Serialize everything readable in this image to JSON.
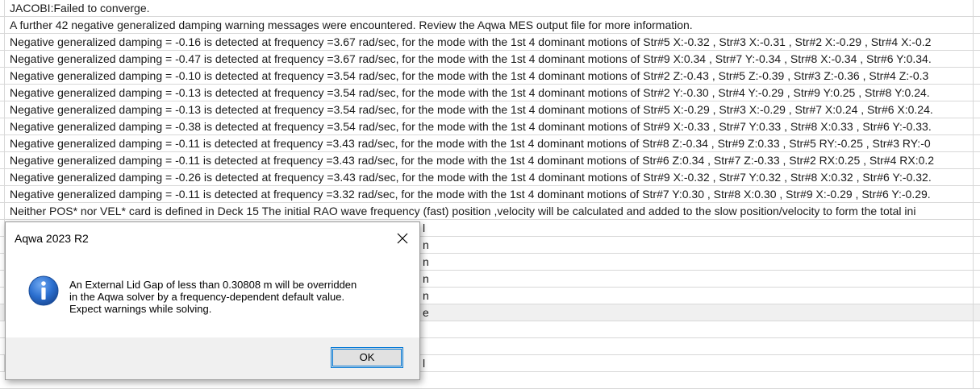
{
  "messages": [
    "JACOBI:Failed to converge.",
    "A further 42 negative generalized damping warning messages were encountered. Review the Aqwa MES output file for more information.",
    "Negative generalized damping = -0.16 is detected at frequency =3.67 rad/sec, for the mode with the 1st 4 dominant motions of Str#5 X:-0.32 , Str#3 X:-0.31 , Str#2 X:-0.29 , Str#4 X:-0.2",
    "Negative generalized damping = -0.47 is detected at frequency =3.67 rad/sec, for the mode with the 1st 4 dominant motions of Str#9 X:0.34 , Str#7 Y:-0.34 , Str#8 X:-0.34 , Str#6 Y:0.34.",
    "Negative generalized damping = -0.10 is detected at frequency =3.54 rad/sec, for the mode with the 1st 4 dominant motions of Str#2 Z:-0.43 , Str#5 Z:-0.39 , Str#3 Z:-0.36 , Str#4 Z:-0.3",
    "Negative generalized damping = -0.13 is detected at frequency =3.54 rad/sec, for the mode with the 1st 4 dominant motions of Str#2 Y:-0.30 , Str#4 Y:-0.29 , Str#9 Y:0.25 , Str#8 Y:0.24.",
    "Negative generalized damping = -0.13 is detected at frequency =3.54 rad/sec, for the mode with the 1st 4 dominant motions of Str#5 X:-0.29 , Str#3 X:-0.29 , Str#7 X:0.24 , Str#6 X:0.24.",
    "Negative generalized damping = -0.38 is detected at frequency =3.54 rad/sec, for the mode with the 1st 4 dominant motions of Str#9 X:-0.33 , Str#7 Y:0.33 , Str#8 X:0.33 , Str#6 Y:-0.33.",
    "Negative generalized damping = -0.11 is detected at frequency =3.43 rad/sec, for the mode with the 1st 4 dominant motions of Str#8 Z:-0.34 , Str#9 Z:0.33 , Str#5 RY:-0.25 , Str#3 RY:-0",
    "Negative generalized damping = -0.11 is detected at frequency =3.43 rad/sec, for the mode with the 1st 4 dominant motions of Str#6 Z:0.34 , Str#7 Z:-0.33 , Str#2 RX:0.25 , Str#4 RX:0.2",
    "Negative generalized damping = -0.26 is detected at frequency =3.43 rad/sec, for the mode with the 1st 4 dominant motions of Str#9 X:-0.32 , Str#7 Y:0.32 , Str#8 X:0.32 , Str#6 Y:-0.32.",
    "Negative generalized damping = -0.11 is detected at frequency =3.32 rad/sec, for the mode with the 1st 4 dominant motions of Str#7 Y:0.30 , Str#8 X:0.30 , Str#9 X:-0.29 , Str#6 Y:-0.29.",
    "Neither POS* nor VEL* card is defined in Deck 15 The initial RAO wave frequency (fast) position ,velocity will be calculated and added to the slow position/velocity to form the total ini"
  ],
  "hidden_rows": [
    "l",
    "n",
    "n",
    "n",
    "n",
    "e",
    "",
    "",
    "",
    "l"
  ],
  "dialog": {
    "title": "Aqwa 2023 R2",
    "message_lines": [
      " An External Lid Gap of less than 0.30808 m will be overridden",
      "in the Aqwa solver by a frequency-dependent default value.",
      "Expect warnings while solving."
    ],
    "ok_label": "OK"
  },
  "colors": {
    "grid_line": "#d8d8d8",
    "dialog_footer": "#f0f0f0",
    "ok_border": "#0078d7",
    "info_icon": "#1b5fb8"
  },
  "icons": {
    "close": "close-icon",
    "info": "info-icon"
  }
}
